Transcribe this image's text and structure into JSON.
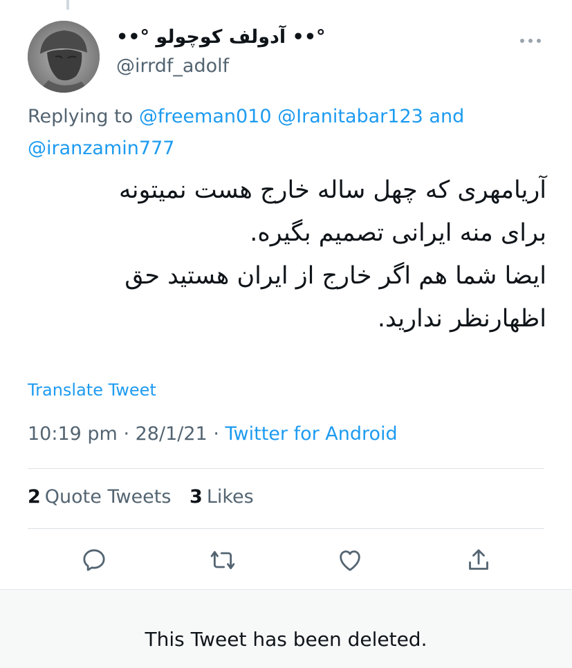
{
  "tweet": {
    "display_name": "°•• آدولف کوچولو °••",
    "handle": "@irrdf_adolf",
    "replying_prefix": "Replying to",
    "mentions": [
      "@freeman010",
      "@Iranitabar123",
      "@iranzamin777"
    ],
    "and_word": "and",
    "text_lines": [
      "آریامهری که چهل ساله خارج هست نمیتونه",
      "برای منه ایرانی تصمیم بگیره.",
      "ایضا شما هم اگر خارج از ایران هستید حق",
      "اظهارنظر ندارید."
    ],
    "translate_label": "Translate Tweet",
    "time": "10:19 pm",
    "date": "28/1/21",
    "separator": "·",
    "source": "Twitter for Android",
    "quote_count": "2",
    "quote_label": "Quote Tweets",
    "like_count": "3",
    "like_label": "Likes"
  },
  "actions": {
    "icons": [
      "reply-icon",
      "retweet-icon",
      "like-icon",
      "share-icon"
    ]
  },
  "deleted_notice": "This Tweet has been deleted.",
  "colors": {
    "accent": "#1d9bf0",
    "secondary_text": "#536471",
    "primary_text": "#0f1419"
  }
}
